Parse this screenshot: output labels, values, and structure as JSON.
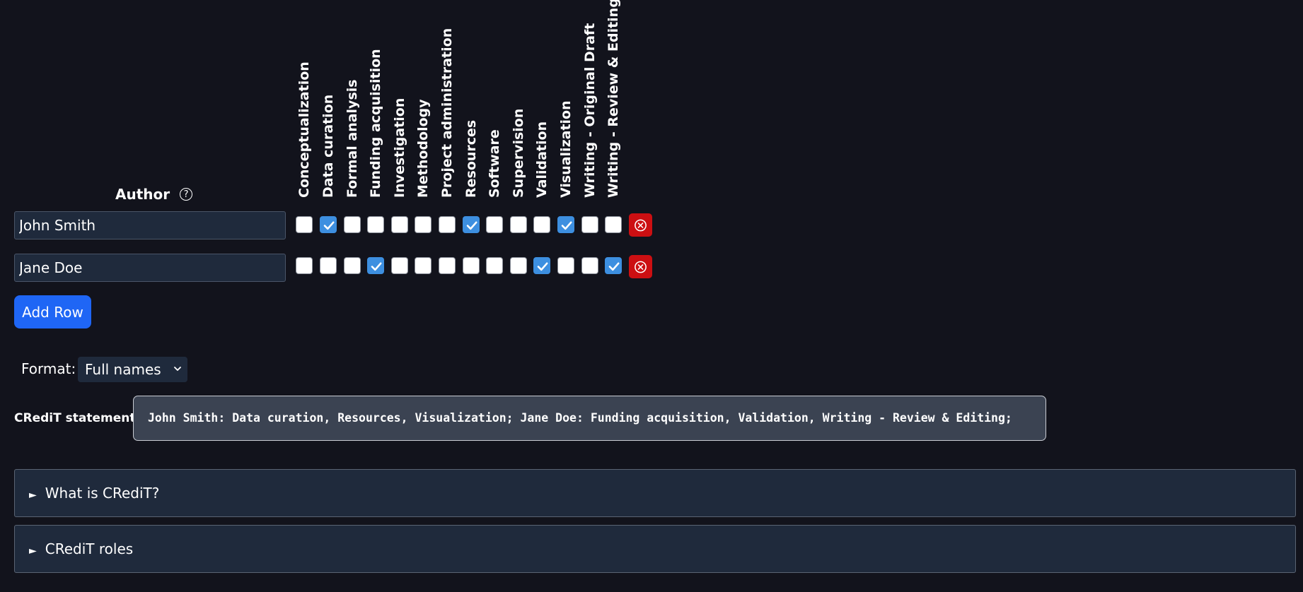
{
  "header": {
    "author_label": "Author",
    "help_glyph": "?",
    "roles": [
      "Conceptualization",
      "Data curation",
      "Formal analysis",
      "Funding acquisition",
      "Investigation",
      "Methodology",
      "Project administration",
      "Resources",
      "Software",
      "Supervision",
      "Validation",
      "Visualization",
      "Writing - Original Draft",
      "Writing - Review & Editing"
    ]
  },
  "rows": [
    {
      "author": "John Smith",
      "checked": [
        false,
        true,
        false,
        false,
        false,
        false,
        false,
        true,
        false,
        false,
        false,
        true,
        false,
        false
      ]
    },
    {
      "author": "Jane Doe",
      "checked": [
        false,
        false,
        false,
        true,
        false,
        false,
        false,
        false,
        false,
        false,
        true,
        false,
        false,
        true
      ]
    }
  ],
  "add_row_label": "Add Row",
  "format": {
    "label": "Format:",
    "selected": "Full names"
  },
  "statement": {
    "label": "CRediT statement",
    "text": "John Smith: Data curation, Resources, Visualization; Jane Doe: Funding acquisition, Validation, Writing - Review & Editing;"
  },
  "sections": [
    {
      "label": "What is CRediT?"
    },
    {
      "label": "CRediT roles"
    }
  ],
  "colors": {
    "background": "#12131c",
    "checked": "#3d8fe0",
    "delete": "#cc0f12",
    "primary": "#1f66f5"
  },
  "icons": {
    "checkmark": "check-icon",
    "delete": "close-circle-icon",
    "help": "help-circle-icon",
    "disclosure": "triangle-right-icon",
    "select": "chevron-down-icon"
  }
}
